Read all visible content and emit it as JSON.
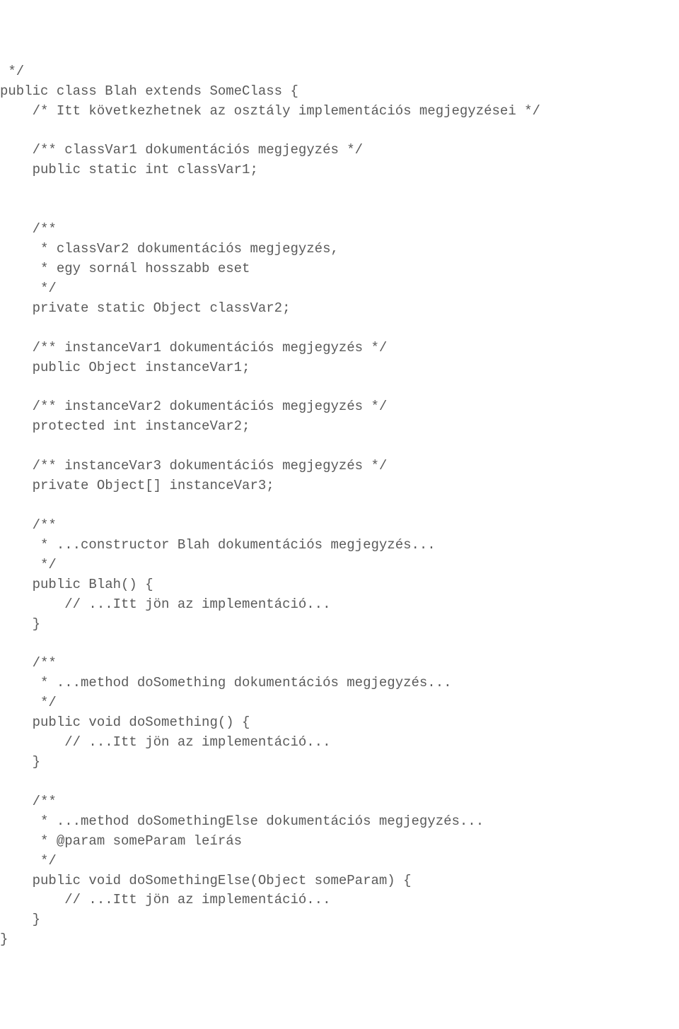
{
  "code": {
    "lines": [
      " */",
      "public class Blah extends SomeClass {",
      "    /* Itt következhetnek az osztály implementációs megjegyzései */",
      "",
      "    /** classVar1 dokumentációs megjegyzés */",
      "    public static int classVar1;",
      "",
      "",
      "    /**",
      "     * classVar2 dokumentációs megjegyzés,",
      "     * egy sornál hosszabb eset",
      "     */",
      "    private static Object classVar2;",
      "",
      "    /** instanceVar1 dokumentációs megjegyzés */",
      "    public Object instanceVar1;",
      "",
      "    /** instanceVar2 dokumentációs megjegyzés */",
      "    protected int instanceVar2;",
      "",
      "    /** instanceVar3 dokumentációs megjegyzés */",
      "    private Object[] instanceVar3;",
      "",
      "    /**",
      "     * ...constructor Blah dokumentációs megjegyzés...",
      "     */",
      "    public Blah() {",
      "        // ...Itt jön az implementáció...",
      "    }",
      "",
      "    /**",
      "     * ...method doSomething dokumentációs megjegyzés...",
      "     */",
      "    public void doSomething() {",
      "        // ...Itt jön az implementáció...",
      "    }",
      "",
      "    /**",
      "     * ...method doSomethingElse dokumentációs megjegyzés...",
      "     * @param someParam leírás",
      "     */",
      "    public void doSomethingElse(Object someParam) {",
      "        // ...Itt jön az implementáció...",
      "    }",
      "}"
    ]
  }
}
